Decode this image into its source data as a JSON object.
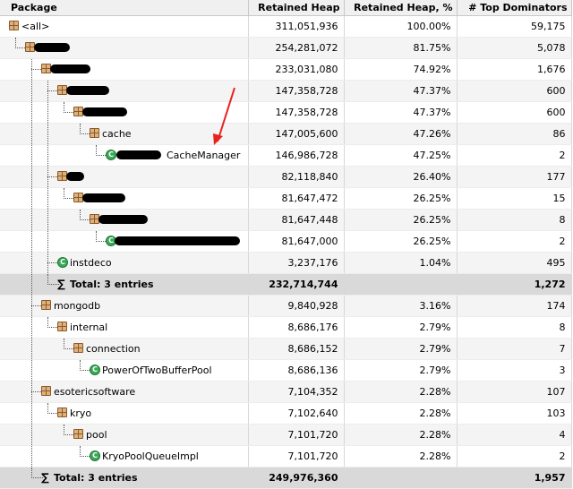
{
  "columns": {
    "package": "Package",
    "retained_heap": "Retained Heap",
    "retained_pct": "Retained Heap, %",
    "top_dominators": "# Top Dominators"
  },
  "rows": [
    {
      "depth": 0,
      "icon": "package",
      "label": "<all>",
      "retained": "311,051,936",
      "pct": "100.00%",
      "dominators": "59,175"
    },
    {
      "depth": 1,
      "icon": "package",
      "label": "",
      "retained": "254,281,072",
      "pct": "81.75%",
      "dominators": "5,078"
    },
    {
      "depth": 2,
      "icon": "package",
      "label": "",
      "retained": "233,031,080",
      "pct": "74.92%",
      "dominators": "1,676"
    },
    {
      "depth": 3,
      "icon": "package",
      "label": "",
      "retained": "147,358,728",
      "pct": "47.37%",
      "dominators": "600"
    },
    {
      "depth": 4,
      "icon": "package",
      "label": "",
      "retained": "147,358,728",
      "pct": "47.37%",
      "dominators": "600"
    },
    {
      "depth": 5,
      "icon": "package",
      "label": "cache",
      "retained": "147,005,600",
      "pct": "47.26%",
      "dominators": "86"
    },
    {
      "depth": 6,
      "icon": "class",
      "label": "CacheManager",
      "retained": "146,986,728",
      "pct": "47.25%",
      "dominators": "2"
    },
    {
      "depth": 3,
      "icon": "package",
      "label": "",
      "retained": "82,118,840",
      "pct": "26.40%",
      "dominators": "177"
    },
    {
      "depth": 4,
      "icon": "package",
      "label": "",
      "retained": "81,647,472",
      "pct": "26.25%",
      "dominators": "15"
    },
    {
      "depth": 5,
      "icon": "package",
      "label": "",
      "retained": "81,647,448",
      "pct": "26.25%",
      "dominators": "8"
    },
    {
      "depth": 6,
      "icon": "class",
      "label": "",
      "retained": "81,647,000",
      "pct": "26.25%",
      "dominators": "2"
    },
    {
      "depth": 3,
      "icon": "class",
      "label": "instdeco",
      "retained": "3,237,176",
      "pct": "1.04%",
      "dominators": "495"
    },
    {
      "depth": 3,
      "icon": "total",
      "label": "Total: 3 entries",
      "retained": "232,714,744",
      "pct": "",
      "dominators": "1,272"
    },
    {
      "depth": 2,
      "icon": "package",
      "label": "mongodb",
      "retained": "9,840,928",
      "pct": "3.16%",
      "dominators": "174"
    },
    {
      "depth": 3,
      "icon": "package",
      "label": "internal",
      "retained": "8,686,176",
      "pct": "2.79%",
      "dominators": "8"
    },
    {
      "depth": 4,
      "icon": "package",
      "label": "connection",
      "retained": "8,686,152",
      "pct": "2.79%",
      "dominators": "7"
    },
    {
      "depth": 5,
      "icon": "class",
      "label": "PowerOfTwoBufferPool",
      "retained": "8,686,136",
      "pct": "2.79%",
      "dominators": "3"
    },
    {
      "depth": 2,
      "icon": "package",
      "label": "esotericsoftware",
      "retained": "7,104,352",
      "pct": "2.28%",
      "dominators": "107"
    },
    {
      "depth": 3,
      "icon": "package",
      "label": "kryo",
      "retained": "7,102,640",
      "pct": "2.28%",
      "dominators": "103"
    },
    {
      "depth": 4,
      "icon": "package",
      "label": "pool",
      "retained": "7,101,720",
      "pct": "2.28%",
      "dominators": "4"
    },
    {
      "depth": 5,
      "icon": "class",
      "label": "KryoPoolQueueImpl",
      "retained": "7,101,720",
      "pct": "2.28%",
      "dominators": "2"
    },
    {
      "depth": 2,
      "icon": "total",
      "label": "Total: 3 entries",
      "retained": "249,976,360",
      "pct": "",
      "dominators": "1,957"
    }
  ],
  "annotation_color": "#e8231c"
}
